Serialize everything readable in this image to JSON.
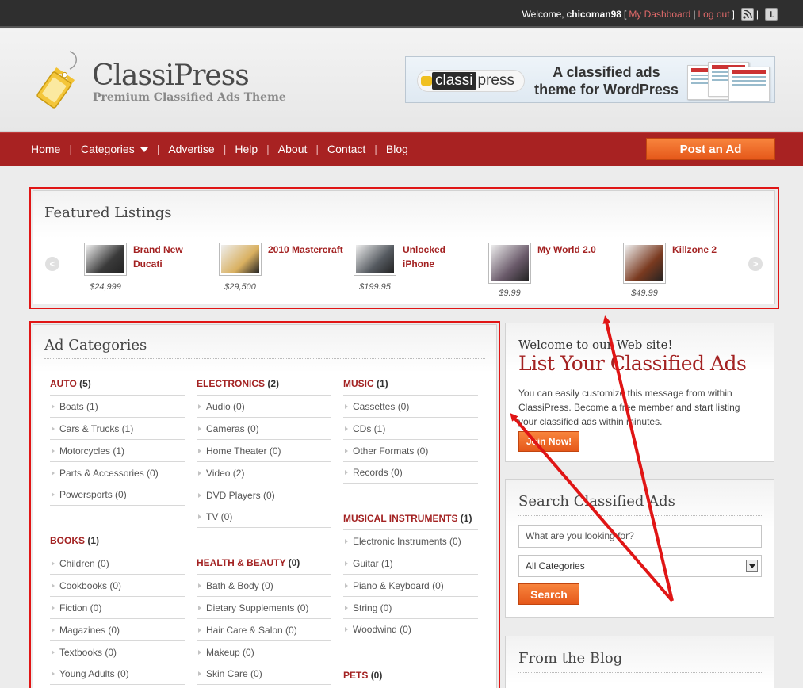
{
  "topbar": {
    "welcome": "Welcome,",
    "user": "chicoman98",
    "open_bracket": "[",
    "dashboard": "My Dashboard",
    "pipe": "|",
    "logout": "Log out",
    "close_bracket": "]",
    "rss_icon": "rss-icon",
    "tumblr_glyph": "t"
  },
  "header": {
    "logo_title": "ClassiPress",
    "logo_subtitle": "Premium Classified Ads Theme",
    "banner": {
      "logo_a": "classi",
      "logo_b": "press",
      "text": "A classified ads theme for WordPress"
    }
  },
  "nav": {
    "items": [
      "Home",
      "Categories",
      "Advertise",
      "Help",
      "About",
      "Contact",
      "Blog"
    ],
    "post_ad": "Post an Ad"
  },
  "featured": {
    "title": "Featured Listings",
    "prev_glyph": "<",
    "next_glyph": ">",
    "items": [
      {
        "title": "Brand New Ducati",
        "price": "$24,999",
        "thumb_color": "#3a3a3a"
      },
      {
        "title": "2010 Mastercraft",
        "price": "$29,500",
        "thumb_color": "#d9b060"
      },
      {
        "title": "Unlocked iPhone",
        "price": "$199.95",
        "thumb_color": "#555a60"
      },
      {
        "title": "My World 2.0",
        "price": "$9.99",
        "thumb_color": "#6a5a6a"
      },
      {
        "title": "Killzone 2",
        "price": "$49.99",
        "thumb_color": "#7a3a20"
      }
    ]
  },
  "categories": {
    "title": "Ad Categories",
    "columns": [
      [
        {
          "name": "AUTO",
          "count": "(5)",
          "subs": [
            "Boats (1)",
            "Cars & Trucks (1)",
            "Motorcycles (1)",
            "Parts & Accessories (0)",
            "Powersports (0)"
          ]
        },
        {
          "name": "BOOKS",
          "count": "(1)",
          "subs": [
            "Children (0)",
            "Cookbooks (0)",
            "Fiction (0)",
            "Magazines (0)",
            "Textbooks (0)",
            "Young Adults (0)"
          ]
        }
      ],
      [
        {
          "name": "ELECTRONICS",
          "count": "(2)",
          "subs": [
            "Audio (0)",
            "Cameras (0)",
            "Home Theater (0)",
            "Video (2)",
            "DVD Players (0)",
            "TV (0)"
          ]
        },
        {
          "name": "HEALTH & BEAUTY",
          "count": "(0)",
          "subs": [
            "Bath & Body (0)",
            "Dietary Supplements (0)",
            "Hair Care & Salon (0)",
            "Makeup (0)",
            "Skin Care (0)"
          ]
        }
      ],
      [
        {
          "name": "MUSIC",
          "count": "(1)",
          "subs": [
            "Cassettes (0)",
            "CDs (1)",
            "Other Formats (0)",
            "Records (0)"
          ]
        },
        {
          "name": "MUSICAL INSTRUMENTS",
          "count": "(1)",
          "subs": [
            "Electronic Instruments (0)",
            "Guitar (1)",
            "Piano & Keyboard (0)",
            "String (0)",
            "Woodwind (0)"
          ]
        },
        {
          "name": "PETS",
          "count": "(0)",
          "subs": []
        }
      ]
    ]
  },
  "welcome": {
    "small": "Welcome to our Web site!",
    "big": "List Your Classified Ads",
    "text": "You can easily customize this message from within ClassiPress. Become a free member and start listing your classified ads within minutes.",
    "button": "Join Now!"
  },
  "search": {
    "title": "Search Classified Ads",
    "placeholder": "What are you looking for?",
    "category": "All Categories",
    "button": "Search"
  },
  "blog": {
    "title": "From the Blog"
  },
  "colors": {
    "brand_red": "#a82222",
    "accent_orange": "#f06a28",
    "annotation_red": "#e01515"
  }
}
